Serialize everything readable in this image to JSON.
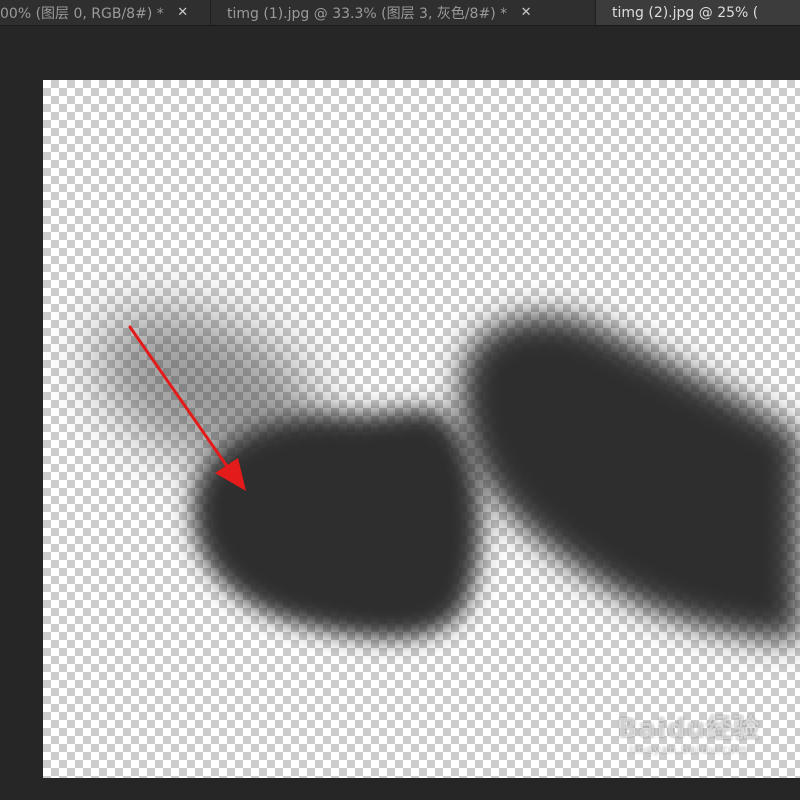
{
  "tabs": [
    {
      "label": "00% (图层 0, RGB/8#) *",
      "close": "✕",
      "active": false
    },
    {
      "label": "timg (1).jpg @ 33.3% (图层 3, 灰色/8#) *",
      "close": "✕",
      "active": false
    },
    {
      "label": "timg (2).jpg @ 25% (",
      "close": "",
      "active": true
    }
  ],
  "canvas": {
    "background": "transparency-checkerboard",
    "shape_color": "#2b2b2b",
    "annotation_color": "#e31b1b",
    "annotation_icon": "red-arrow"
  },
  "watermark": {
    "main": "Baidu经验",
    "sub": "jingyan.baidu.com"
  }
}
